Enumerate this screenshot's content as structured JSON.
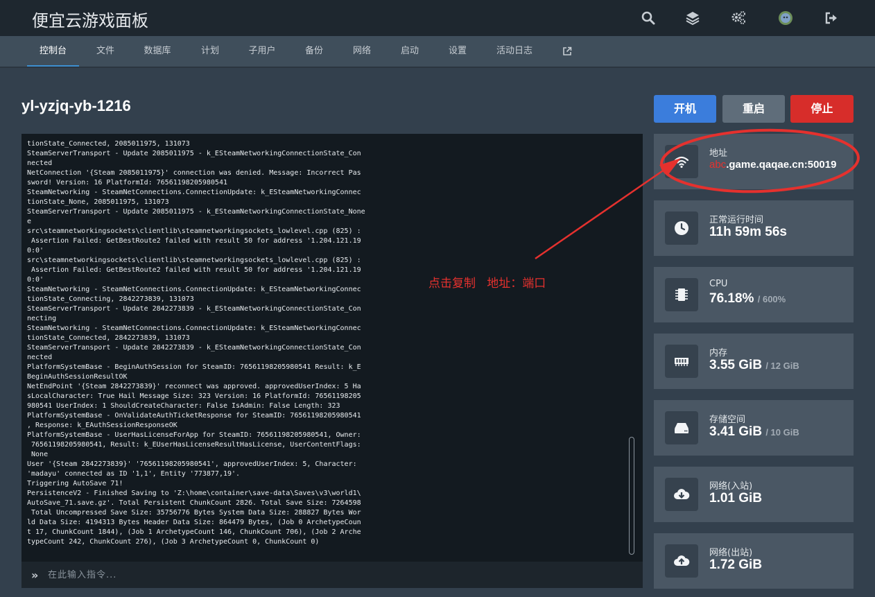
{
  "header": {
    "brand": "便宜云游戏面板",
    "icons": [
      "search-icon",
      "layers-icon",
      "settings-icon",
      "avatar-icon",
      "logout-icon"
    ]
  },
  "tabs": [
    {
      "label": "控制台",
      "active": true
    },
    {
      "label": "文件"
    },
    {
      "label": "数据库"
    },
    {
      "label": "计划"
    },
    {
      "label": "子用户"
    },
    {
      "label": "备份"
    },
    {
      "label": "网络"
    },
    {
      "label": "启动"
    },
    {
      "label": "设置"
    },
    {
      "label": "活动日志"
    },
    {
      "icon": "external-link-icon"
    }
  ],
  "server": {
    "name": "yl-yzjq-yb-1216"
  },
  "power": {
    "start": "开机",
    "restart": "重启",
    "stop": "停止"
  },
  "console": {
    "lines": "tionState_Connected, 2085011975, 131073\nSteamServerTransport - Update 2085011975 - k_ESteamNetworkingConnectionState_Con\nnected\nNetConnection '{Steam 2085011975}' connection was denied. Message: Incorrect Pas\nsword! Version: 16 PlatformId: 76561198205980541\nSteamNetworking - SteamNetConnections.ConnectionUpdate: k_ESteamNetworkingConnec\ntionState_None, 2085011975, 131073\nSteamServerTransport - Update 2085011975 - k_ESteamNetworkingConnectionState_None\ne\nsrc\\steamnetworkingsockets\\clientlib\\steamnetworkingsockets_lowlevel.cpp (825) :\n Assertion Failed: GetBestRoute2 failed with result 50 for address '1.204.121.19\n0:0'\nsrc\\steamnetworkingsockets\\clientlib\\steamnetworkingsockets_lowlevel.cpp (825) :\n Assertion Failed: GetBestRoute2 failed with result 50 for address '1.204.121.19\n0:0'\nSteamNetworking - SteamNetConnections.ConnectionUpdate: k_ESteamNetworkingConnec\ntionState_Connecting, 2842273839, 131073\nSteamServerTransport - Update 2842273839 - k_ESteamNetworkingConnectionState_Con\nnecting\nSteamNetworking - SteamNetConnections.ConnectionUpdate: k_ESteamNetworkingConnec\ntionState_Connected, 2842273839, 131073\nSteamServerTransport - Update 2842273839 - k_ESteamNetworkingConnectionState_Con\nnected\nPlatformSystemBase - BeginAuthSession for SteamID: 76561198205980541 Result: k_E\nBeginAuthSessionResultOK\nNetEndPoint '{Steam 2842273839}' reconnect was approved. approvedUserIndex: 5 Ha\nsLocalCharacter: True Hail Message Size: 323 Version: 16 PlatformId: 76561198205\n980541 UserIndex: 1 ShouldCreateCharacter: False IsAdmin: False Length: 323\nPlatformSystemBase - OnValidateAuthTicketResponse for SteamID: 76561198205980541\n, Response: k_EAuthSessionResponseOK\nPlatformSystemBase - UserHasLicenseForApp for SteamID: 76561198205980541, Owner:\n 76561198205980541, Result: k_EUserHasLicenseResultHasLicense, UserContentFlags:\n None\nUser '{Steam 2842273839}' '76561198205980541', approvedUserIndex: 5, Character:\n'madayu' connected as ID '1,1', Entity '773877,19'.\nTriggering AutoSave 71!\nPersistenceV2 - Finished Saving to 'Z:\\home\\container\\save-data\\Saves\\v3\\world1\\\nAutoSave_71.save.gz'. Total Persistent ChunkCount 2826. Total Save Size: 7264598\n Total Uncompressed Save Size: 35756776 Bytes System Data Size: 288827 Bytes Wor\nld Data Size: 4194313 Bytes Header Data Size: 864479 Bytes, (Job 0 ArchetypeCoun\nt 17, ChunkCount 1844), (Job 1 ArchetypeCount 146, ChunkCount 706), (Job 2 Arche\ntypeCount 242, ChunkCount 276), (Job 3 ArchetypeCount 0, ChunkCount 0)",
    "prompt_symbol": "»",
    "placeholder": "在此输入指令..."
  },
  "stats": {
    "address": {
      "label": "地址",
      "prefix": "abc",
      "value": ".game.qaqae.cn:50019",
      "icon": "wifi-icon"
    },
    "uptime": {
      "label": "正常运行时间",
      "value": "11h 59m 56s",
      "icon": "clock-icon"
    },
    "cpu": {
      "label": "CPU",
      "value": "76.18%",
      "limit": "/ 600%",
      "icon": "chip-icon"
    },
    "memory": {
      "label": "内存",
      "value": "3.55 GiB",
      "limit": "/ 12 GiB",
      "icon": "memory-icon"
    },
    "disk": {
      "label": "存储空间",
      "value": "3.41 GiB",
      "limit": "/ 10 GiB",
      "icon": "hdd-icon"
    },
    "net_in": {
      "label": "网络(入站)",
      "value": "1.01 GiB",
      "icon": "cloud-download-icon"
    },
    "net_out": {
      "label": "网络(出站)",
      "value": "1.72 GiB",
      "icon": "cloud-upload-icon"
    }
  },
  "annotation": {
    "text": "点击复制   地址：端口",
    "color": "#e5312e"
  }
}
